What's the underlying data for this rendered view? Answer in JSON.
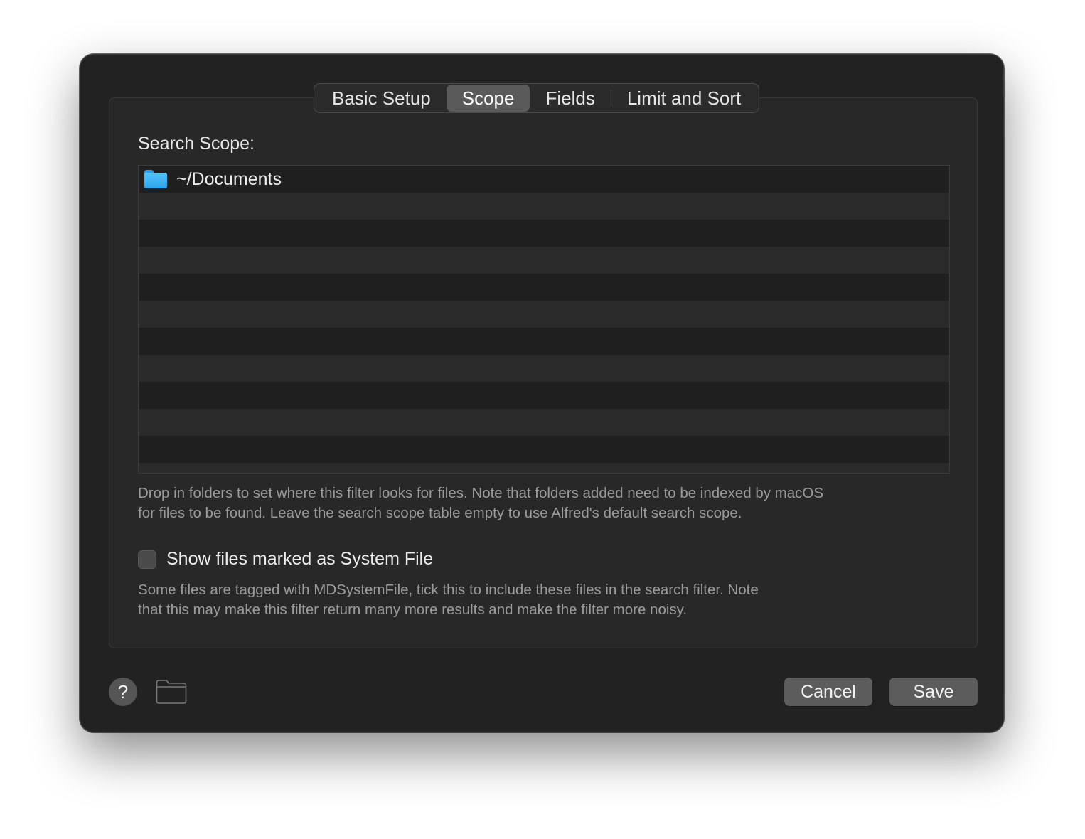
{
  "tabs": [
    {
      "label": "Basic Setup"
    },
    {
      "label": "Scope"
    },
    {
      "label": "Fields"
    },
    {
      "label": "Limit and Sort"
    }
  ],
  "active_tab": "Scope",
  "scope": {
    "label": "Search Scope:",
    "entries": [
      {
        "icon": "folder-icon",
        "path": "~/Documents"
      }
    ],
    "help_line_1": "Drop in folders to set where this filter looks for files. Note that folders added need to be indexed by macOS",
    "help_line_2": "for files to be found. Leave the search scope table empty to use Alfred's default search scope."
  },
  "system_files": {
    "label": "Show files marked as System File",
    "checked": false,
    "help_line_1": "Some files are tagged with MDSystemFile, tick this to include these files in the search filter. Note",
    "help_line_2": "that this may make this filter return many more results and make the filter more noisy."
  },
  "footer": {
    "help_glyph": "?",
    "cancel_label": "Cancel",
    "save_label": "Save"
  },
  "colors": {
    "window_bg": "#222222",
    "panel_bg": "#282828",
    "folder_accent": "#3db3f5",
    "button_bg": "#5c5c5c"
  }
}
